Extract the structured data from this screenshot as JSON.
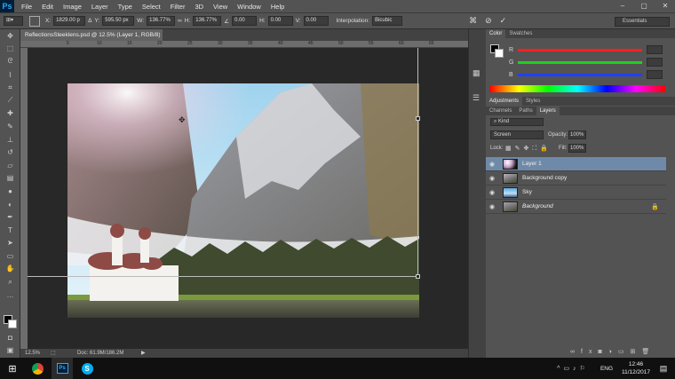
{
  "app": {
    "logo": "Ps"
  },
  "menu": [
    "File",
    "Edit",
    "Image",
    "Layer",
    "Type",
    "Select",
    "Filter",
    "3D",
    "View",
    "Window",
    "Help"
  ],
  "window_controls": [
    "–",
    "▢",
    "✕"
  ],
  "options_bar": {
    "x_label": "X:",
    "x_value": "1829.00 p",
    "y_label": "Y:",
    "y_value": "595.50 px",
    "w_label": "W:",
    "w_value": "136.77%",
    "h_label": "H:",
    "h_value": "136.77%",
    "angle_value": "0.00",
    "hskew_label": "H:",
    "hskew_value": "0.00",
    "vskew_label": "V:",
    "vskew_value": "0.00",
    "interp_label": "Interpolation:",
    "interp_value": "Bicubic",
    "workspace": "Essentials"
  },
  "document": {
    "tab_title": "ReflectionsSteeklens.psd @ 12.5% (Layer 1, RGB/8) *"
  },
  "status": {
    "zoom": "12.5%",
    "doc": "Doc: 61.9M/186.2M"
  },
  "ruler_h": [
    "5",
    "10",
    "15",
    "20",
    "25",
    "30",
    "35",
    "40",
    "45",
    "50",
    "55",
    "60",
    "65"
  ],
  "color_panel": {
    "tabs": [
      "Color",
      "Swatches"
    ],
    "channels": [
      "R",
      "G",
      "B"
    ],
    "colors": {
      "r": "#ff2020",
      "g": "#20d020",
      "b": "#2040ff"
    }
  },
  "adjust_panel": {
    "tabs": [
      "Adjustments",
      "Styles"
    ]
  },
  "layers_panel": {
    "tabs": [
      "Channels",
      "Paths",
      "Layers"
    ],
    "kind": "Kind",
    "blend_mode": "Screen",
    "opacity_label": "Opacity:",
    "opacity": "100%",
    "lock_label": "Lock:",
    "fill_label": "Fill:",
    "fill": "100%",
    "layers": [
      {
        "name": "Layer 1",
        "selected": true,
        "italic": false
      },
      {
        "name": "Background copy",
        "selected": false,
        "italic": false
      },
      {
        "name": "Sky",
        "selected": false,
        "italic": false
      },
      {
        "name": "Background",
        "selected": false,
        "italic": true
      }
    ]
  },
  "taskbar": {
    "lang": "ENG",
    "time": "12:46",
    "date": "11/12/2017"
  }
}
